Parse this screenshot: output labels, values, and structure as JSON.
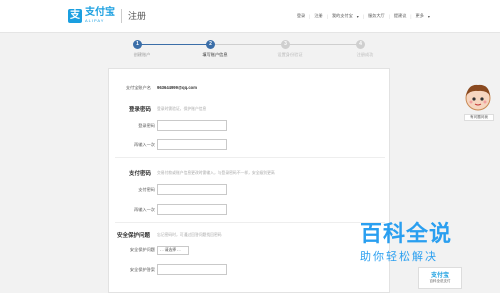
{
  "header": {
    "logo_mark": "支",
    "logo_cn": "支付宝",
    "logo_en": "ALIPAY",
    "page_title": "注册",
    "nav": [
      "登录",
      "注册",
      "我的支付宝",
      "服务大厅",
      "提建议",
      "更多"
    ]
  },
  "steps": [
    {
      "num": "1",
      "label": "创建账户",
      "state": "done"
    },
    {
      "num": "2",
      "label": "填写账户信息",
      "state": "active"
    },
    {
      "num": "3",
      "label": "设置身份验证",
      "state": "todo"
    },
    {
      "num": "4",
      "label": "注册成功",
      "state": "todo"
    }
  ],
  "colors": {
    "accent": "#1a9fe0",
    "step_active": "#3b6ea8",
    "step_todo": "#cfcfcf"
  },
  "form": {
    "account_label": "支付宝账户名",
    "account_value": "963644999@qq.com",
    "login_pwd_title": "登录密码",
    "login_pwd_note": "登录时需验证，保护账户信息",
    "login_pwd_label": "登录密码",
    "login_pwd_confirm_label": "再输入一次",
    "pay_pwd_title": "支付密码",
    "pay_pwd_note": "交易付款或账户信息更改时需输入，与登录密码不一样，安全级别更高",
    "pay_pwd_label": "支付密码",
    "pay_pwd_confirm_label": "再输入一次",
    "security_title": "安全保护问题",
    "security_note": "忘记密码时，可通过回答问题找回密码",
    "security_q_label": "安全保护问题",
    "security_q_value": "- - 请选择 - -",
    "security_a_label": "安全保护答案"
  },
  "avatar": {
    "label": "有问题问我"
  },
  "watermark": {
    "title": "百科全说",
    "subtitle": "助你轻松解决"
  },
  "mini_badge": {
    "logo": "支付宝",
    "sub": "百科全说支付"
  }
}
